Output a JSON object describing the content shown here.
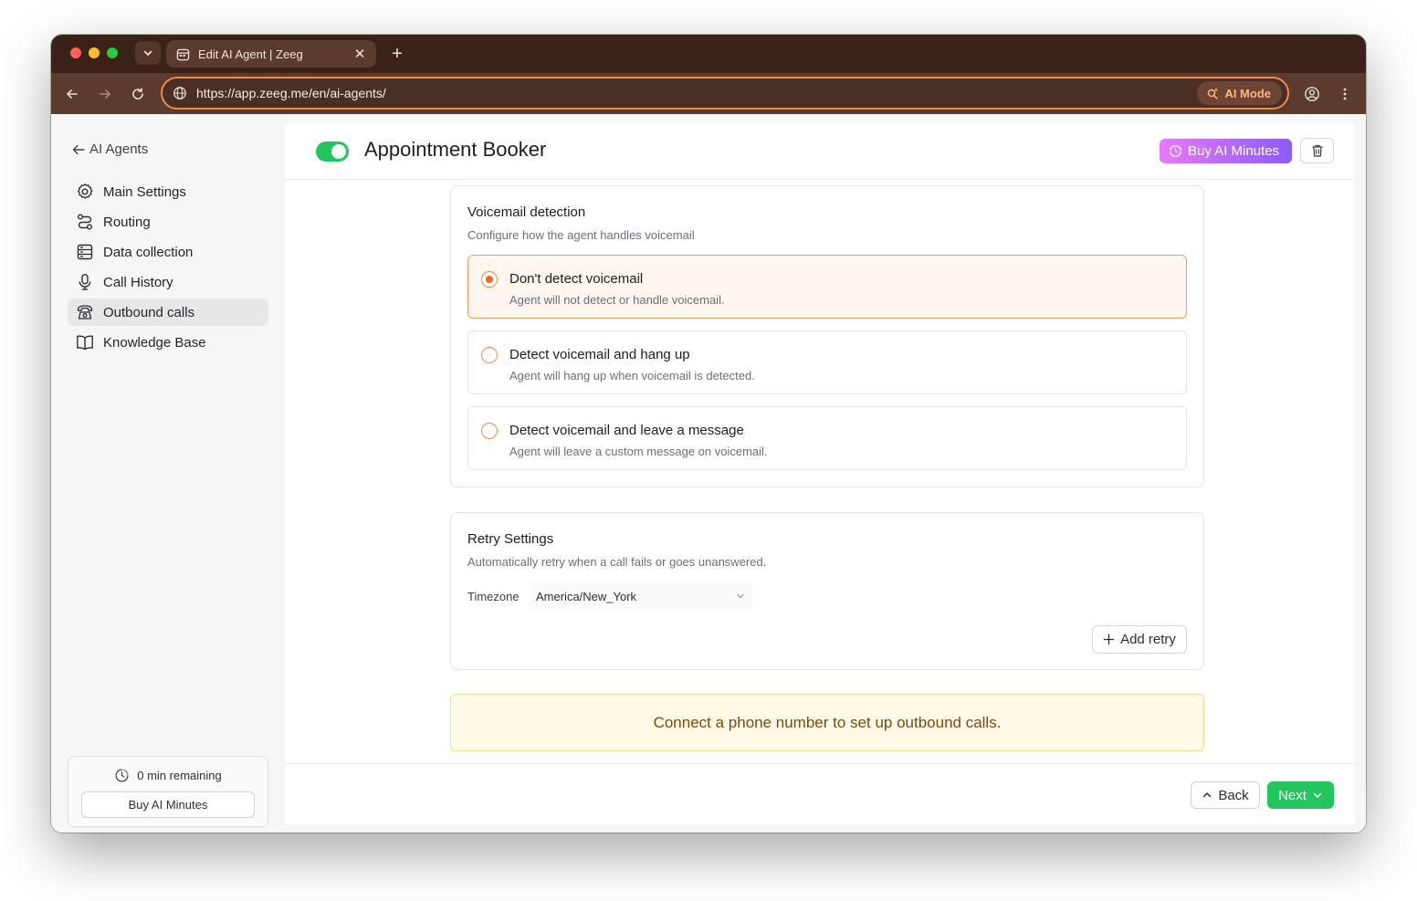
{
  "browser": {
    "tab_title": "Edit AI Agent | Zeeg",
    "url": "https://app.zeeg.me/en/ai-agents/",
    "ai_mode_label": "AI Mode",
    "accent": "#f08a4b"
  },
  "sidebar": {
    "back_label": "AI Agents",
    "items": [
      {
        "label": "Main Settings",
        "icon": "gear-icon"
      },
      {
        "label": "Routing",
        "icon": "route-icon"
      },
      {
        "label": "Data collection",
        "icon": "form-icon"
      },
      {
        "label": "Call History",
        "icon": "microphone-icon"
      },
      {
        "label": "Outbound calls",
        "icon": "phone-icon",
        "active": true
      },
      {
        "label": "Knowledge Base",
        "icon": "book-icon"
      }
    ],
    "minutes": {
      "remaining_label": "0 min remaining",
      "buy_label": "Buy AI Minutes"
    }
  },
  "header": {
    "title": "Appointment Booker",
    "enabled": true,
    "buy_label": "Buy AI Minutes"
  },
  "voicemail": {
    "title": "Voicemail detection",
    "subtitle": "Configure how the agent handles voicemail",
    "options": [
      {
        "title": "Don't detect voicemail",
        "desc": "Agent will not detect or handle voicemail.",
        "selected": true
      },
      {
        "title": "Detect voicemail and hang up",
        "desc": "Agent will hang up when voicemail is detected.",
        "selected": false
      },
      {
        "title": "Detect voicemail and leave a message",
        "desc": "Agent will leave a custom message on voicemail.",
        "selected": false
      }
    ]
  },
  "retry": {
    "title": "Retry Settings",
    "subtitle": "Automatically retry when a call fails or goes unanswered.",
    "timezone_label": "Timezone",
    "timezone_value": "America/New_York",
    "add_retry_label": "Add retry"
  },
  "notice": {
    "text": "Connect a phone number to set up outbound calls."
  },
  "footer": {
    "back_label": "Back",
    "next_label": "Next"
  },
  "colors": {
    "toggle_on": "#22c55e",
    "next_button": "#22c55e",
    "radio_selected": "#f26a1b",
    "notice_bg": "#fffae6"
  }
}
